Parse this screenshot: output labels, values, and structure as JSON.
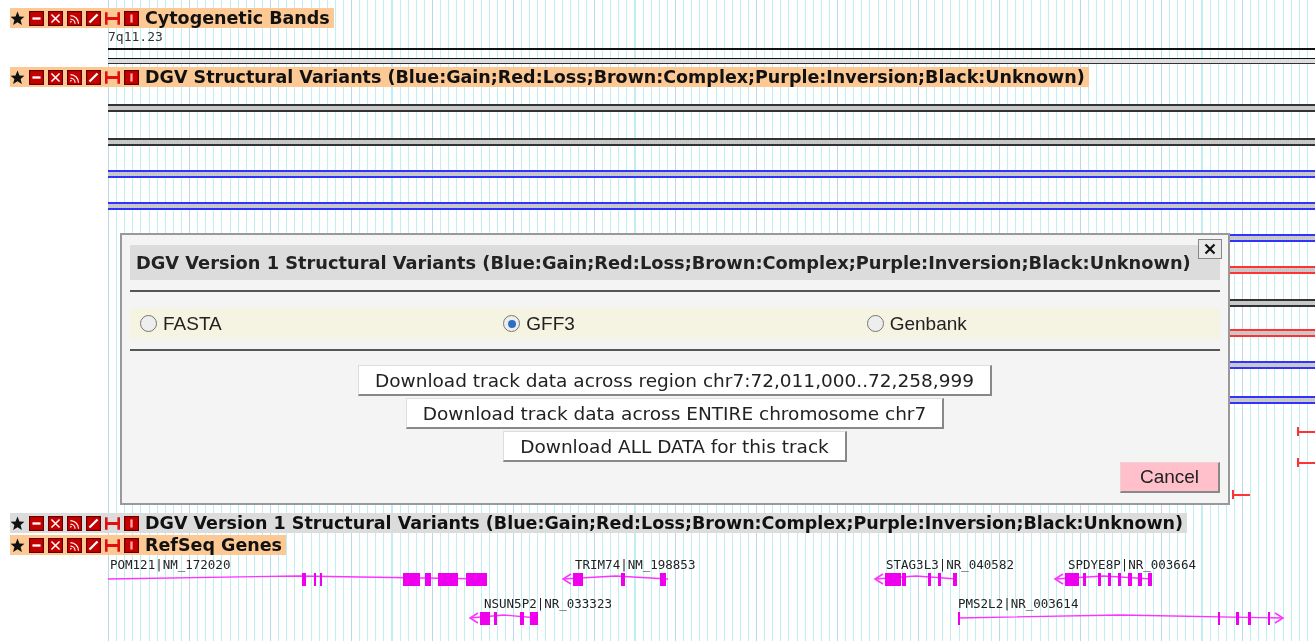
{
  "tracks": [
    {
      "kind": "cytoband",
      "label": "Cytogenetic Bands",
      "active": false,
      "band": "7q11.23"
    },
    {
      "kind": "variants",
      "label": "DGV Structural Variants (Blue:Gain;Red:Loss;Brown:Complex;Purple:Inversion;Black:Unknown)",
      "active": false,
      "features": [
        {
          "color": "#333333"
        },
        {
          "color": "#333333"
        },
        {
          "color": "#3333ff"
        },
        {
          "color": "#3333ff"
        },
        {
          "color": "#3333ff"
        },
        {
          "color": "#ff3333"
        },
        {
          "color": "#333333"
        },
        {
          "color": "#ff3333"
        },
        {
          "color": "#3333ff"
        },
        {
          "color": "#3333ff"
        },
        {
          "color": "#ff3333"
        },
        {
          "color": "#ff3333"
        },
        {
          "color": "#ff3333"
        }
      ]
    },
    {
      "kind": "variants",
      "label": "DGV Version 1 Structural Variants (Blue:Gain;Red:Loss;Brown:Complex;Purple:Inversion;Black:Unknown)",
      "active": true
    },
    {
      "kind": "genes",
      "label": "RefSeq Genes",
      "active": false,
      "genes": [
        {
          "name": "POM121|NM_172020"
        },
        {
          "name": "TRIM74|NM_198853",
          "reverse": true
        },
        {
          "name": "NSUN5P2|NR_033323",
          "reverse": true
        },
        {
          "name": "STAG3L3|NR_040582",
          "reverse": true
        },
        {
          "name": "SPDYE8P|NR_003664",
          "reverse": true
        },
        {
          "name": "PMS2L2|NR_003614",
          "reverse": false
        }
      ]
    }
  ],
  "dialog": {
    "title": "DGV Version 1 Structural Variants (Blue:Gain;Red:Loss;Brown:Complex;Purple:Inversion;Black:Unknown)",
    "formats": [
      {
        "label": "FASTA",
        "selected": false
      },
      {
        "label": "GFF3",
        "selected": true
      },
      {
        "label": "Genbank",
        "selected": false
      }
    ],
    "actions": [
      "Download track data across region chr7:72,011,000..72,258,999",
      "Download track data across ENTIRE chromosome chr7",
      "Download ALL DATA for this track"
    ],
    "cancel": "Cancel"
  }
}
